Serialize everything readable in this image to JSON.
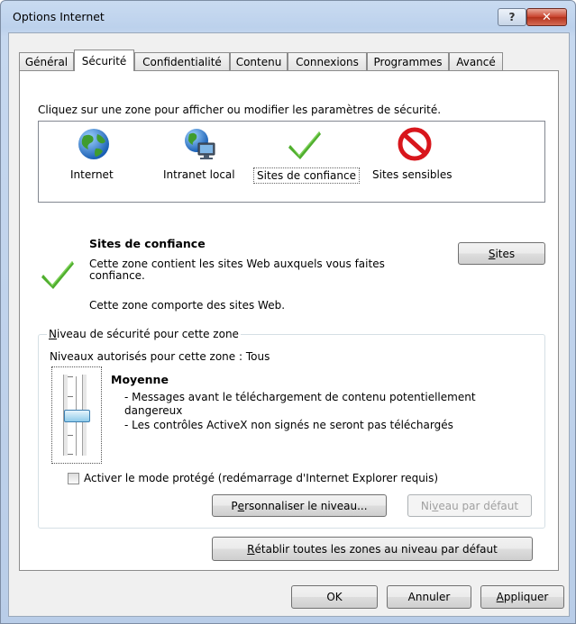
{
  "window": {
    "title": "Options Internet",
    "help_glyph": "?",
    "close_glyph": "✕"
  },
  "tabs": [
    {
      "label": "Général"
    },
    {
      "label": "Sécurité"
    },
    {
      "label": "Confidentialité"
    },
    {
      "label": "Contenu"
    },
    {
      "label": "Connexions"
    },
    {
      "label": "Programmes"
    },
    {
      "label": "Avancé"
    }
  ],
  "zones": {
    "instruction": "Cliquez sur une zone pour afficher ou modifier les paramètres de sécurité.",
    "items": [
      {
        "label": "Internet",
        "icon": "globe-icon"
      },
      {
        "label": "Intranet local",
        "icon": "intranet-icon"
      },
      {
        "label": "Sites de confiance",
        "icon": "checkmark-icon"
      },
      {
        "label": "Sites sensibles",
        "icon": "restricted-icon"
      }
    ],
    "selected": "Sites de confiance"
  },
  "zone_info": {
    "title": "Sites de confiance",
    "description_line1": "Cette zone contient les sites Web auxquels vous faites",
    "description_line2": "confiance.",
    "contains": "Cette zone comporte des sites Web.",
    "sites_button": {
      "underline": "S",
      "rest": "ites"
    }
  },
  "security_level": {
    "legend_underline": "N",
    "legend_rest": "iveau de sécurité pour cette zone",
    "allowed": "Niveaux autorisés pour cette zone : Tous",
    "level_name": "Moyenne",
    "bullet1_line1": "- Messages avant le téléchargement de contenu potentiellement",
    "bullet1_line2": "dangereux",
    "bullet2": "- Les contrôles ActiveX non signés ne seront pas téléchargés",
    "slider_level": "Moyenne",
    "protected_mode_label": "Activer le mode protégé (redémarrage d'Internet Explorer requis)",
    "protected_mode_checked": false,
    "custom_button": {
      "before": "P",
      "underline": "e",
      "after": "rsonnaliser le niveau..."
    },
    "default_button": {
      "before": "Ni",
      "underline": "v",
      "after": "eau par défaut"
    }
  },
  "reset_all_button": {
    "underline": "R",
    "rest": "établir toutes les zones au niveau par défaut"
  },
  "footer": {
    "ok_label": "OK",
    "cancel_label": "Annuler",
    "apply_underline": "A",
    "apply_rest": "ppliquer"
  },
  "colors": {
    "accent_green": "#4fae2e",
    "restricted_red": "#d8161c",
    "title_bar": "#c6d8ef"
  }
}
